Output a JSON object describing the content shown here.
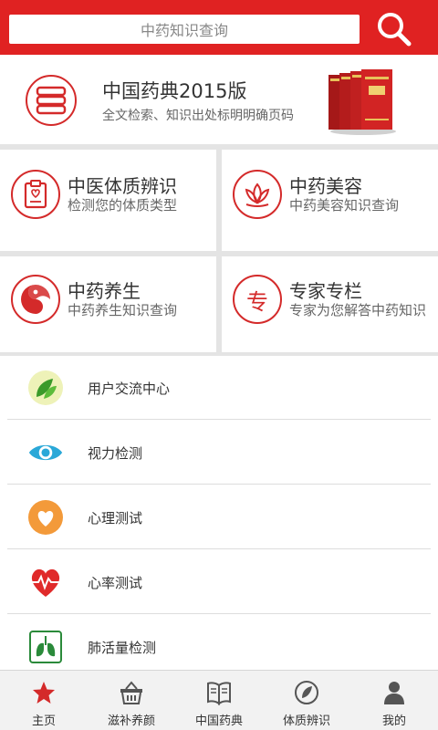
{
  "header": {
    "search_placeholder": "中药知识查询",
    "search_icon": "search-icon",
    "brand_color": "#e02222"
  },
  "banner": {
    "title": "中国药典2015版",
    "subtitle": "全文检索、知识出处标明明确页码",
    "icon": "books-icon"
  },
  "tiles": [
    {
      "title": "中医体质辨识",
      "subtitle": "检测您的体质类型",
      "icon": "clipboard-heart-icon"
    },
    {
      "title": "中药美容",
      "subtitle": "中药美容知识查询",
      "icon": "lotus-icon"
    },
    {
      "title": "中药养生",
      "subtitle": "中药养生知识查询",
      "icon": "taiji-icon"
    },
    {
      "title": "专家专栏",
      "subtitle": "专家为您解答中药知识",
      "icon": "expert-icon",
      "glyph": "专"
    }
  ],
  "list": [
    {
      "label": "用户交流中心",
      "icon": "leaf-icon"
    },
    {
      "label": "视力检测",
      "icon": "eye-icon"
    },
    {
      "label": "心理测试",
      "icon": "heart-icon"
    },
    {
      "label": "心率测试",
      "icon": "heartbeat-icon"
    },
    {
      "label": "肺活量检测",
      "icon": "lungs-icon"
    }
  ],
  "nav": [
    {
      "label": "主页",
      "icon": "star-icon",
      "active": true
    },
    {
      "label": "滋补养颜",
      "icon": "basket-icon"
    },
    {
      "label": "中国药典",
      "icon": "book-icon"
    },
    {
      "label": "体质辨识",
      "icon": "constitution-icon"
    },
    {
      "label": "我的",
      "icon": "user-icon"
    }
  ]
}
